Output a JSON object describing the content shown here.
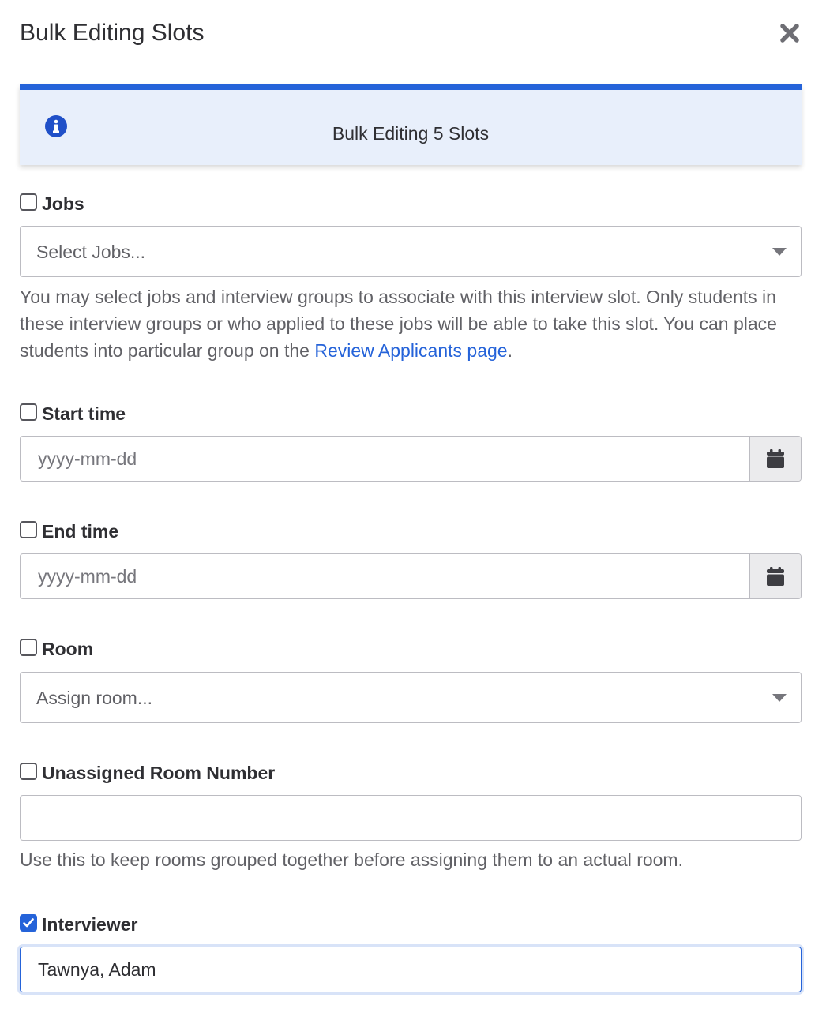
{
  "modal": {
    "title": "Bulk Editing Slots",
    "close_icon": "close-icon"
  },
  "alert": {
    "icon": "info-icon",
    "text": "Bulk Editing 5 Slots",
    "accent_color": "#2563d9",
    "background_color": "#e8effb"
  },
  "fields": {
    "jobs": {
      "label": "Jobs",
      "checked": false,
      "placeholder": "Select Jobs...",
      "help_before": "You may select jobs and interview groups to associate with this interview slot. Only students in these interview groups or who applied to these jobs will be able to take this slot. You can place students into particular group on the ",
      "help_link": "Review Applicants page",
      "help_after": "."
    },
    "start_time": {
      "label": "Start time",
      "checked": false,
      "placeholder": "yyyy-mm-dd",
      "button_icon": "calendar-icon"
    },
    "end_time": {
      "label": "End time",
      "checked": false,
      "placeholder": "yyyy-mm-dd",
      "button_icon": "calendar-icon"
    },
    "room": {
      "label": "Room",
      "checked": false,
      "placeholder": "Assign room..."
    },
    "unassigned_room": {
      "label": "Unassigned Room Number",
      "checked": false,
      "value": "",
      "help": "Use this to keep rooms grouped together before assigning them to an actual room."
    },
    "interviewer": {
      "label": "Interviewer",
      "checked": true,
      "value": "Tawnya, Adam"
    }
  }
}
